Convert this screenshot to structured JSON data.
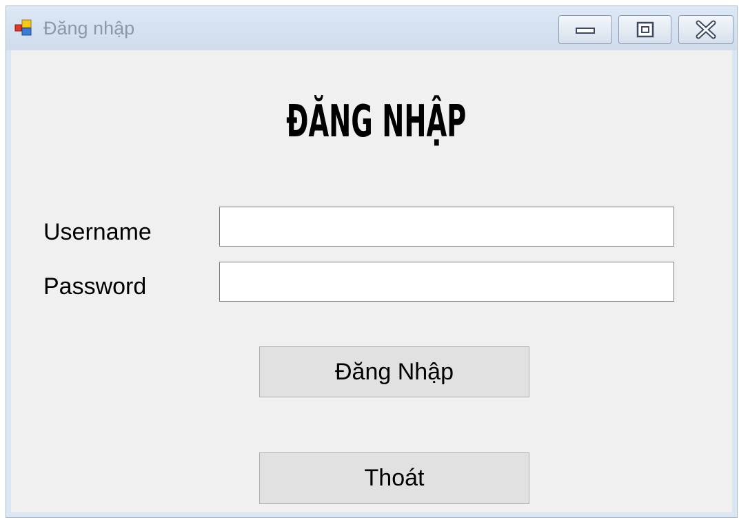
{
  "window": {
    "title": "Đăng nhập",
    "controls": {
      "minimize": "minimize",
      "maximize": "maximize",
      "close": "close"
    }
  },
  "form": {
    "heading": "ĐĂNG NHẬP",
    "username_label": "Username",
    "username_value": "",
    "password_label": "Password",
    "password_value": "",
    "login_button": "Đăng Nhập",
    "exit_button": "Thoát"
  },
  "icons": {
    "app": "app-window-icon",
    "minimize": "minimize-icon",
    "maximize": "maximize-icon",
    "close": "close-icon"
  },
  "colors": {
    "titlebar": "#d6e2f0",
    "client": "#f0f0f0",
    "button_face": "#e1e1e1",
    "input_border": "#7a7a7a"
  }
}
